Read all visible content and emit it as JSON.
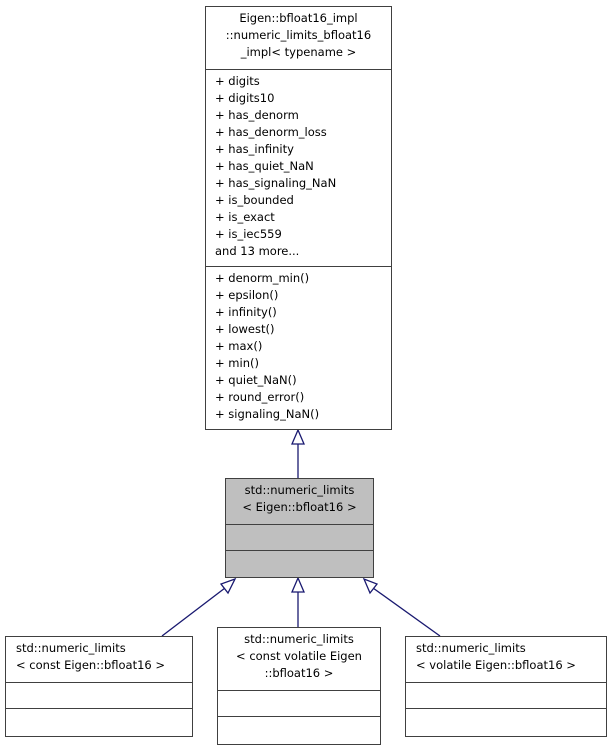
{
  "diagram": {
    "edge_color": "#191970",
    "highlight_fill": "#bfbfbf",
    "base": {
      "title_lines": [
        "Eigen::bfloat16_impl",
        "::numeric_limits_bfloat16",
        "_impl< typename >"
      ],
      "attributes": [
        "+ digits",
        "+ digits10",
        "+ has_denorm",
        "+ has_denorm_loss",
        "+ has_infinity",
        "+ has_quiet_NaN",
        "+ has_signaling_NaN",
        "+ is_bounded",
        "+ is_exact",
        "+ is_iec559",
        "and 13 more..."
      ],
      "methods": [
        "+ denorm_min()",
        "+ epsilon()",
        "+ infinity()",
        "+ lowest()",
        "+ max()",
        "+ min()",
        "+ quiet_NaN()",
        "+ round_error()",
        "+ signaling_NaN()"
      ]
    },
    "current": {
      "title_lines": [
        "std::numeric_limits",
        "< Eigen::bfloat16 >"
      ]
    },
    "children": [
      {
        "title_lines": [
          "std::numeric_limits",
          "< const Eigen::bfloat16 >"
        ]
      },
      {
        "title_lines": [
          "std::numeric_limits",
          "< const volatile Eigen",
          "::bfloat16 >"
        ]
      },
      {
        "title_lines": [
          "std::numeric_limits",
          "< volatile Eigen::bfloat16 >"
        ]
      }
    ]
  }
}
